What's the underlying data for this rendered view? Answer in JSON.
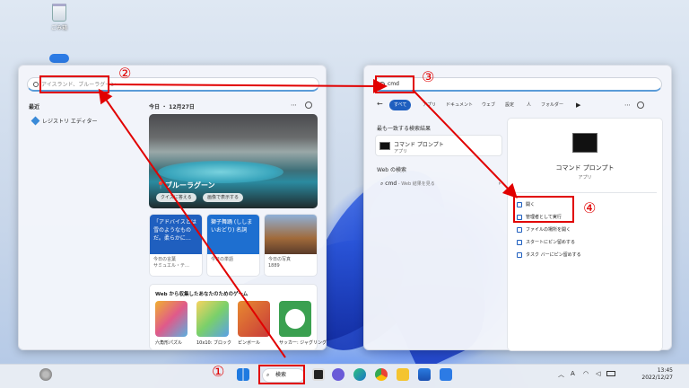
{
  "desktop": {
    "recycle_label": "ごみ箱"
  },
  "start_panel": {
    "search_placeholder": "アイスランド、ブルーラグーン",
    "recent_title": "最近",
    "recent_item": "レジストリ エディター",
    "today_title": "今日 ・ 12月27日",
    "hero_title": "ブルーラグーン",
    "hero_btn1": "クイズに答える",
    "hero_btn2": "画像で表示する",
    "cards": [
      {
        "top": "「アドバイスとは雪のようなものだ。柔らかに…",
        "foot1": "今日の言葉",
        "foot2": "サミュエル・テ…",
        "color": "#1f5fbf"
      },
      {
        "top": "獅子舞踊 (ししまいおどり) 名詞",
        "foot1": "今日の単語",
        "foot2": "",
        "color": "#1e6fd0"
      },
      {
        "top": "",
        "foot1": "今日の写真",
        "foot2": "1889",
        "color": "#7a5a3a"
      }
    ],
    "games_title": "Web から収集したあなたのためのゲーム",
    "games": [
      "六角形パズル",
      "10x10: ブロック",
      "ピンボール",
      "サッカー: ジャグリング"
    ]
  },
  "search_panel": {
    "query": "cmd",
    "tabs": [
      "すべて",
      "アプリ",
      "ドキュメント",
      "ウェブ",
      "設定",
      "人",
      "フォルダー"
    ],
    "best_match_title": "最も一致する検索結果",
    "best_match_name": "コマンド プロンプト",
    "best_match_type": "アプリ",
    "web_title": "Web の検索",
    "web_query": "cmd",
    "web_hint": " - Web 結果を見る",
    "detail_name": "コマンド プロンプト",
    "detail_type": "アプリ",
    "actions": [
      "開く",
      "管理者として実行",
      "ファイルの場所を開く",
      "スタートにピン留めする",
      "タスク バーにピン留めする"
    ]
  },
  "taskbar": {
    "search_label": "検索",
    "time": "13:45",
    "date": "2022/12/27"
  },
  "annotations": [
    "①",
    "②",
    "③",
    "④"
  ],
  "colors": {
    "accent": "#1f5fbf",
    "annotation": "#e10000"
  }
}
